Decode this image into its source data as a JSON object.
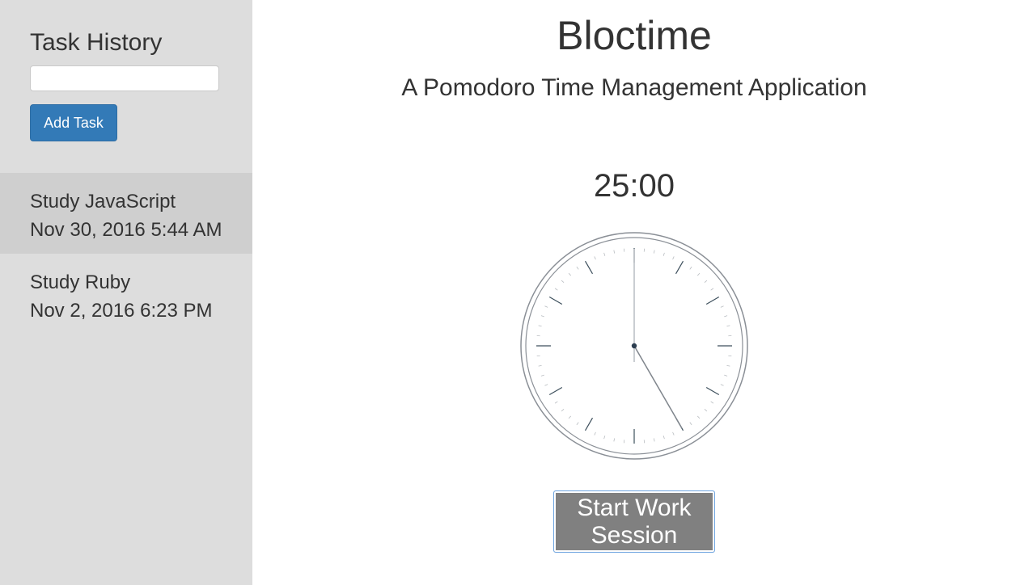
{
  "sidebar": {
    "title": "Task History",
    "task_input": {
      "value": "",
      "placeholder": ""
    },
    "add_task_label": "Add Task",
    "tasks": [
      {
        "name": "Study JavaScript",
        "date": "Nov 30, 2016 5:44 AM",
        "active": true
      },
      {
        "name": "Study Ruby",
        "date": "Nov 2, 2016 6:23 PM",
        "active": false
      }
    ]
  },
  "main": {
    "title": "Bloctime",
    "subtitle": "A Pomodoro Time Management Application",
    "timer": "25:00",
    "start_button_label": "Start Work Session"
  },
  "colors": {
    "sidebar_bg": "#dddddd",
    "active_task_bg": "#cfcfcf",
    "primary_button": "#337ab7",
    "start_button": "#808080"
  }
}
